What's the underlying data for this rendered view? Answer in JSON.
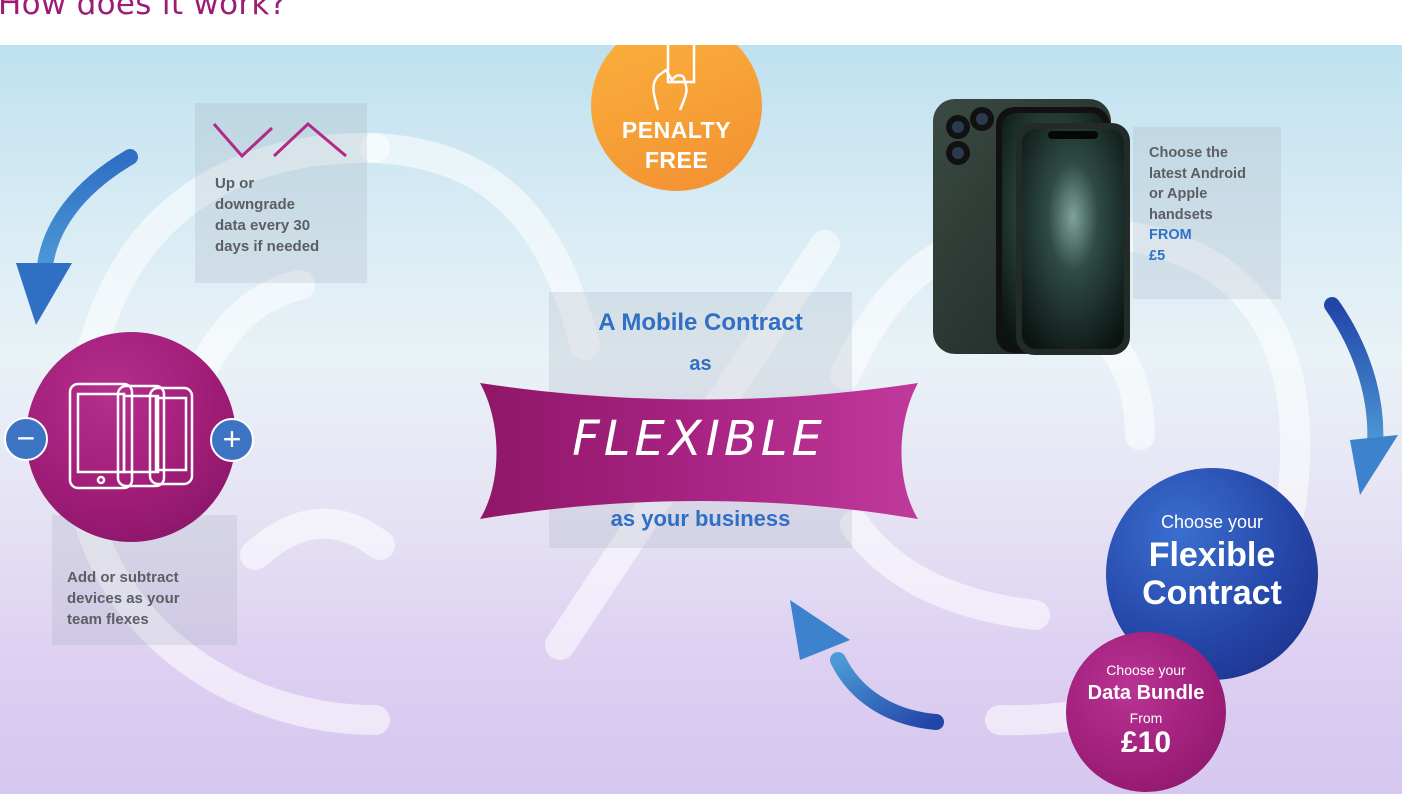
{
  "heading": "How does it work?",
  "penalty": {
    "line1": "PENALTY",
    "line2": "FREE",
    "icon": "hand-holding-card-icon"
  },
  "data_box": {
    "text_lines": [
      "Up or",
      "downgrade",
      "data every 30",
      "days if needed"
    ],
    "icon": "zigzag-updown-icon"
  },
  "handsets": {
    "text_lines": [
      "Choose the",
      "latest Android",
      "or Apple",
      "handsets"
    ],
    "from_label": "FROM",
    "price": "£5",
    "image": "smartphones-image"
  },
  "devices": {
    "text_lines": [
      "Add or subtract",
      "devices as your",
      "team flexes"
    ],
    "minus": "−",
    "plus": "+",
    "icon": "stacked-tablets-icon"
  },
  "center": {
    "line1": "A Mobile Contract",
    "line2": "as",
    "banner": "FLEXIBLE",
    "line3": "as your business"
  },
  "contract": {
    "small": "Choose your",
    "big1": "Flexible",
    "big2": "Contract"
  },
  "bundle": {
    "small": "Choose your",
    "title": "Data Bundle",
    "from": "From",
    "price": "£10"
  },
  "colors": {
    "magenta": "#9c1d74",
    "blue": "#2d73c6",
    "orange": "#f7a137",
    "navy": "#2446a8"
  }
}
